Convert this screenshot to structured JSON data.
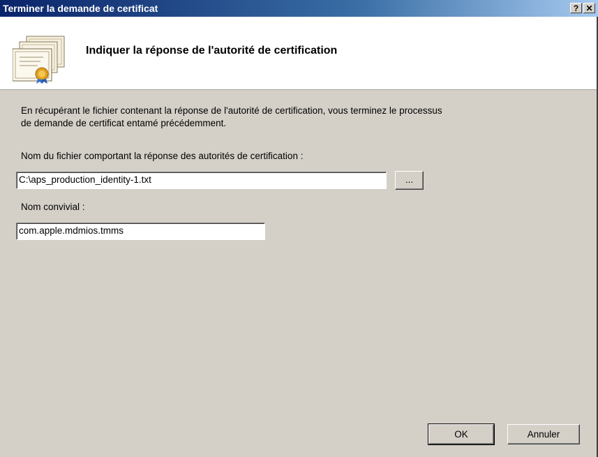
{
  "window": {
    "title": "Terminer la demande de certificat",
    "help_button": "?",
    "close_button": "✕"
  },
  "header": {
    "heading": "Indiquer la réponse de l'autorité de certification",
    "icon": "certificate-icon"
  },
  "body": {
    "description": "En récupérant le fichier contenant la réponse de l'autorité de certification, vous terminez le processus",
    "description_line2": "de demande de certificat entamé précédemment.",
    "file_label": "Nom du fichier comportant la réponse des autorités de certification :",
    "file_value": "C:\\aps_production_identity-1.txt",
    "browse_label": "...",
    "friendly_label": "Nom convivial :",
    "friendly_value": "com.apple.mdmios.tmms"
  },
  "footer": {
    "ok_label": "OK",
    "cancel_label": "Annuler"
  }
}
